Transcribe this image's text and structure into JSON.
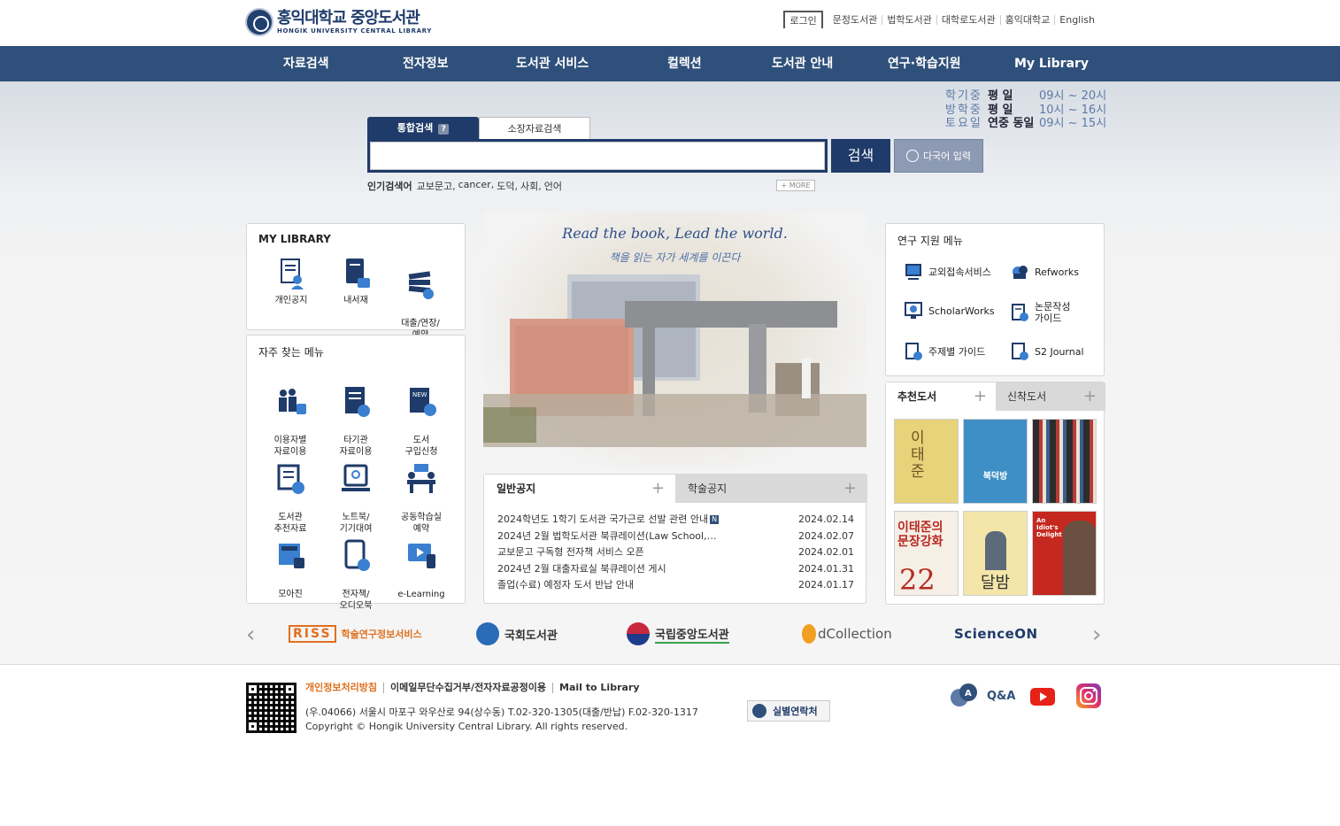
{
  "header": {
    "logo_ko": "홍익대학교 중앙도서관",
    "logo_en": "HONGIK UNIVERSITY   CENTRAL LIBRARY",
    "login": "로그인",
    "util_links": [
      "문정도서관",
      "법학도서관",
      "대학로도서관",
      "홍익대학교",
      "English"
    ]
  },
  "nav": [
    "자료검색",
    "전자정보",
    "도서관 서비스",
    "컬렉션",
    "도서관 안내",
    "연구·학습지원",
    "My Library"
  ],
  "hours": [
    {
      "label": "학기중",
      "day": "평      일",
      "time": "09시 ~ 20시"
    },
    {
      "label": "방학중",
      "day": "평      일",
      "time": "10시 ~ 16시"
    },
    {
      "label": "토요일",
      "day": "연중 동일",
      "time": "09시 ~ 15시"
    }
  ],
  "search": {
    "tab_integrated": "통합검색",
    "tab_help": "?",
    "tab_holdings": "소장자료검색",
    "placeholder": "",
    "button": "검색",
    "multilang": "다국어 입력",
    "popular_label": "인기검색어",
    "popular_keywords": [
      "교보문고,",
      "cancer,",
      "도덕,",
      "사회,",
      "언어"
    ],
    "more": "+ MORE"
  },
  "my_library": {
    "title": "MY LIBRARY",
    "items": [
      "개인공지",
      "내서재",
      "대출/연장/\n예약"
    ]
  },
  "frequent_menu": {
    "title": "자주 찾는 메뉴",
    "items": [
      "이용자별\n자료이용",
      "타기관\n자료이용",
      "도서\n구입신청",
      "도서관\n추천자료",
      "노트북/\n기기대여",
      "공동학습실\n예약",
      "모아진",
      "전자책/\n오디오북",
      "e-Learning"
    ]
  },
  "campus": {
    "slogan_en": "Read the book, Lead the world.",
    "slogan_ko": "책을 읽는 자가 세계를 이끈다"
  },
  "notices": {
    "tab_general": "일반공지",
    "tab_academic": "학술공지",
    "plus": "+",
    "new_badge": "N",
    "rows": [
      {
        "title": "2024학년도 1학기 도서관 국가근로 선발 관련 안내",
        "date": "2024.02.14",
        "new": true
      },
      {
        "title": "2024년 2월 법학도서관 북큐레이션(Law School,…",
        "date": "2024.02.07",
        "new": false
      },
      {
        "title": "교보문고 구독형 전자책 서비스 오픈",
        "date": "2024.02.01",
        "new": false
      },
      {
        "title": "2024년 2월 대출자료실 북큐레이션 게시",
        "date": "2024.01.31",
        "new": false
      },
      {
        "title": "졸업(수료) 예정자 도서 반납 안내",
        "date": "2024.01.17",
        "new": false
      }
    ]
  },
  "research_menu": {
    "title": "연구 지원 메뉴",
    "items": [
      "교외접속서비스",
      "Refworks",
      "ScholarWorks",
      "논문작성\n가이드",
      "주제별 가이드",
      "S2 Journal"
    ]
  },
  "books": {
    "tab_recommended": "추천도서",
    "tab_new": "신착도서",
    "plus": "+",
    "covers": [
      {
        "title": "이태준",
        "bg": "#e8d27a",
        "fg": "#6b5520"
      },
      {
        "title": "북덕방",
        "bg": "#3f8fc7",
        "fg": "#ffffff"
      },
      {
        "title": "",
        "bg": "#2c2c2c",
        "fg": "#ffffff"
      },
      {
        "title": "이태준의\n문장강화",
        "bg": "#f6efe6",
        "fg": "#b52a22"
      },
      {
        "title": "달밤",
        "bg": "#f3e6a8",
        "fg": "#333333"
      },
      {
        "title": "An Idiot's Delight",
        "bg": "#c5281f",
        "fg": "#ffffff"
      }
    ]
  },
  "banners": [
    "학술연구정보서비스",
    "국회도서관",
    "국립중앙도서관",
    "dCollection",
    "ScienceON"
  ],
  "banner_prev": "‹",
  "banner_next": "›",
  "footer": {
    "links": [
      "개인정보처리방침",
      "이메일무단수집거부/전자자료공정이용",
      "Mail to Library"
    ],
    "address": "(우.04066) 서울시 마포구 와우산로 94(상수동) T.02-320-1305(대출/반납) F.02-320-1317",
    "copyright": "Copyright © Hongik University Central Library. All rights reserved.",
    "contact_button": "실별연락처",
    "qna": "Q&A"
  },
  "colors": {
    "navy": "#1f3b6a",
    "nav_bg": "#2f507a",
    "accent_orange": "#e0701e"
  }
}
